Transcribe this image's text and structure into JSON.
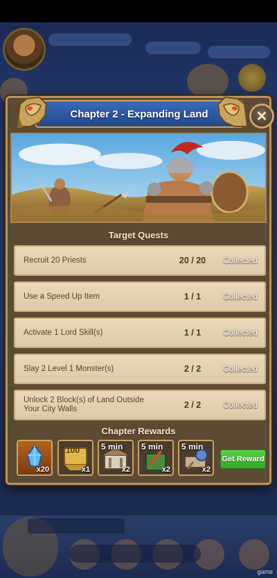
{
  "dialog": {
    "title": "Chapter 2 - Expanding Land",
    "close_symbol": "✕"
  },
  "quests_heading": "Target Quests",
  "quests": [
    {
      "name": "Recruit 20 Priests",
      "progress": "20 / 20",
      "status": "Collected"
    },
    {
      "name": "Use a Speed Up Item",
      "progress": "1 / 1",
      "status": "Collected"
    },
    {
      "name": "Activate 1 Lord Skill(s)",
      "progress": "1 / 1",
      "status": "Collected"
    },
    {
      "name": "Slay 2 Level 1 Monster(s)",
      "progress": "2 / 2",
      "status": "Collected"
    },
    {
      "name": "Unlock 2 Block(s) of Land Outside Your City Walls",
      "progress": "2 / 2",
      "status": "Collected"
    }
  ],
  "rewards_heading": "Chapter Rewards",
  "rewards": [
    {
      "icon": "blue-crystal-icon",
      "label": "",
      "count": "x20"
    },
    {
      "icon": "gold-100-icon",
      "label": "100",
      "count": "x1"
    },
    {
      "icon": "speedup-building-icon",
      "label": "5 min",
      "count": "x2"
    },
    {
      "icon": "speedup-training-icon",
      "label": "5 min",
      "count": "x2"
    },
    {
      "icon": "speedup-research-icon",
      "label": "5 min",
      "count": "x2"
    }
  ],
  "get_reward_label": "Get Reward",
  "corner_tag": "game",
  "colors": {
    "banner_blue": "#2b56a0",
    "frame_gold": "#c9a560",
    "panel_brown": "#5d4a33",
    "row_parchment": "#e8d9b8",
    "button_green": "#33a52a"
  }
}
